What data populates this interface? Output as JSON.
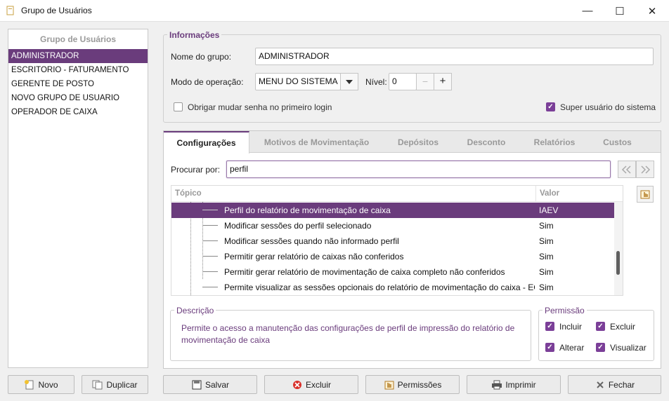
{
  "window": {
    "title": "Grupo de Usuários",
    "minimize": "—",
    "maximize": "☐",
    "close": "✕"
  },
  "sidebar": {
    "header": "Grupo de Usuários",
    "items": [
      "ADMINISTRADOR",
      "ESCRITORIO - FATURAMENTO",
      "GERENTE DE POSTO",
      "NOVO GRUPO DE USUARIO",
      "OPERADOR DE CAIXA"
    ],
    "selected_index": 0,
    "new_label": "Novo",
    "duplicate_label": "Duplicar"
  },
  "info": {
    "legend": "Informações",
    "group_name_label": "Nome do grupo:",
    "group_name_value": "ADMINISTRADOR",
    "mode_label": "Modo de operação:",
    "mode_value": "MENU DO SISTEMA",
    "level_label": "Nível:",
    "level_value": "0",
    "force_password_label": "Obrigar mudar senha no primeiro login",
    "force_password_checked": false,
    "super_user_label": "Super usuário do sistema",
    "super_user_checked": true
  },
  "tabs": [
    "Configurações",
    "Motivos de Movimentação",
    "Depósitos",
    "Desconto",
    "Relatórios",
    "Custos"
  ],
  "active_tab": 0,
  "search": {
    "label": "Procurar por:",
    "value": "perfil"
  },
  "grid": {
    "headers": {
      "topic": "Tópico",
      "value": "Valor"
    },
    "rows": [
      {
        "topic": "Perfil do relatório de movimentação de caixa",
        "value": "IAEV",
        "selected": true
      },
      {
        "topic": "Modificar sessões do perfil selecionado",
        "value": "Sim"
      },
      {
        "topic": "Modificar sessões quando não informado perfil",
        "value": "Sim"
      },
      {
        "topic": "Permitir gerar relatório de caixas não conferidos",
        "value": "Sim"
      },
      {
        "topic": "Permitir gerar relatório de movimentação de caixa completo não conferidos",
        "value": "Sim"
      },
      {
        "topic": "Permite visualizar as sessões opcionais do relatório de movimentação do caixa - ECF",
        "value": "Sim"
      }
    ]
  },
  "description": {
    "legend": "Descrição",
    "text": "Permite o acesso a manutenção das configurações de perfil de impressão do relatório de movimentação de caixa"
  },
  "permission": {
    "legend": "Permissão",
    "include": "Incluir",
    "delete": "Excluir",
    "change": "Alterar",
    "view": "Visualizar"
  },
  "footer": {
    "save": "Salvar",
    "delete": "Excluir",
    "permissions": "Permissões",
    "print": "Imprimir",
    "close": "Fechar"
  },
  "colors": {
    "accent": "#6a3c7c",
    "checkbox": "#7b3f98"
  }
}
